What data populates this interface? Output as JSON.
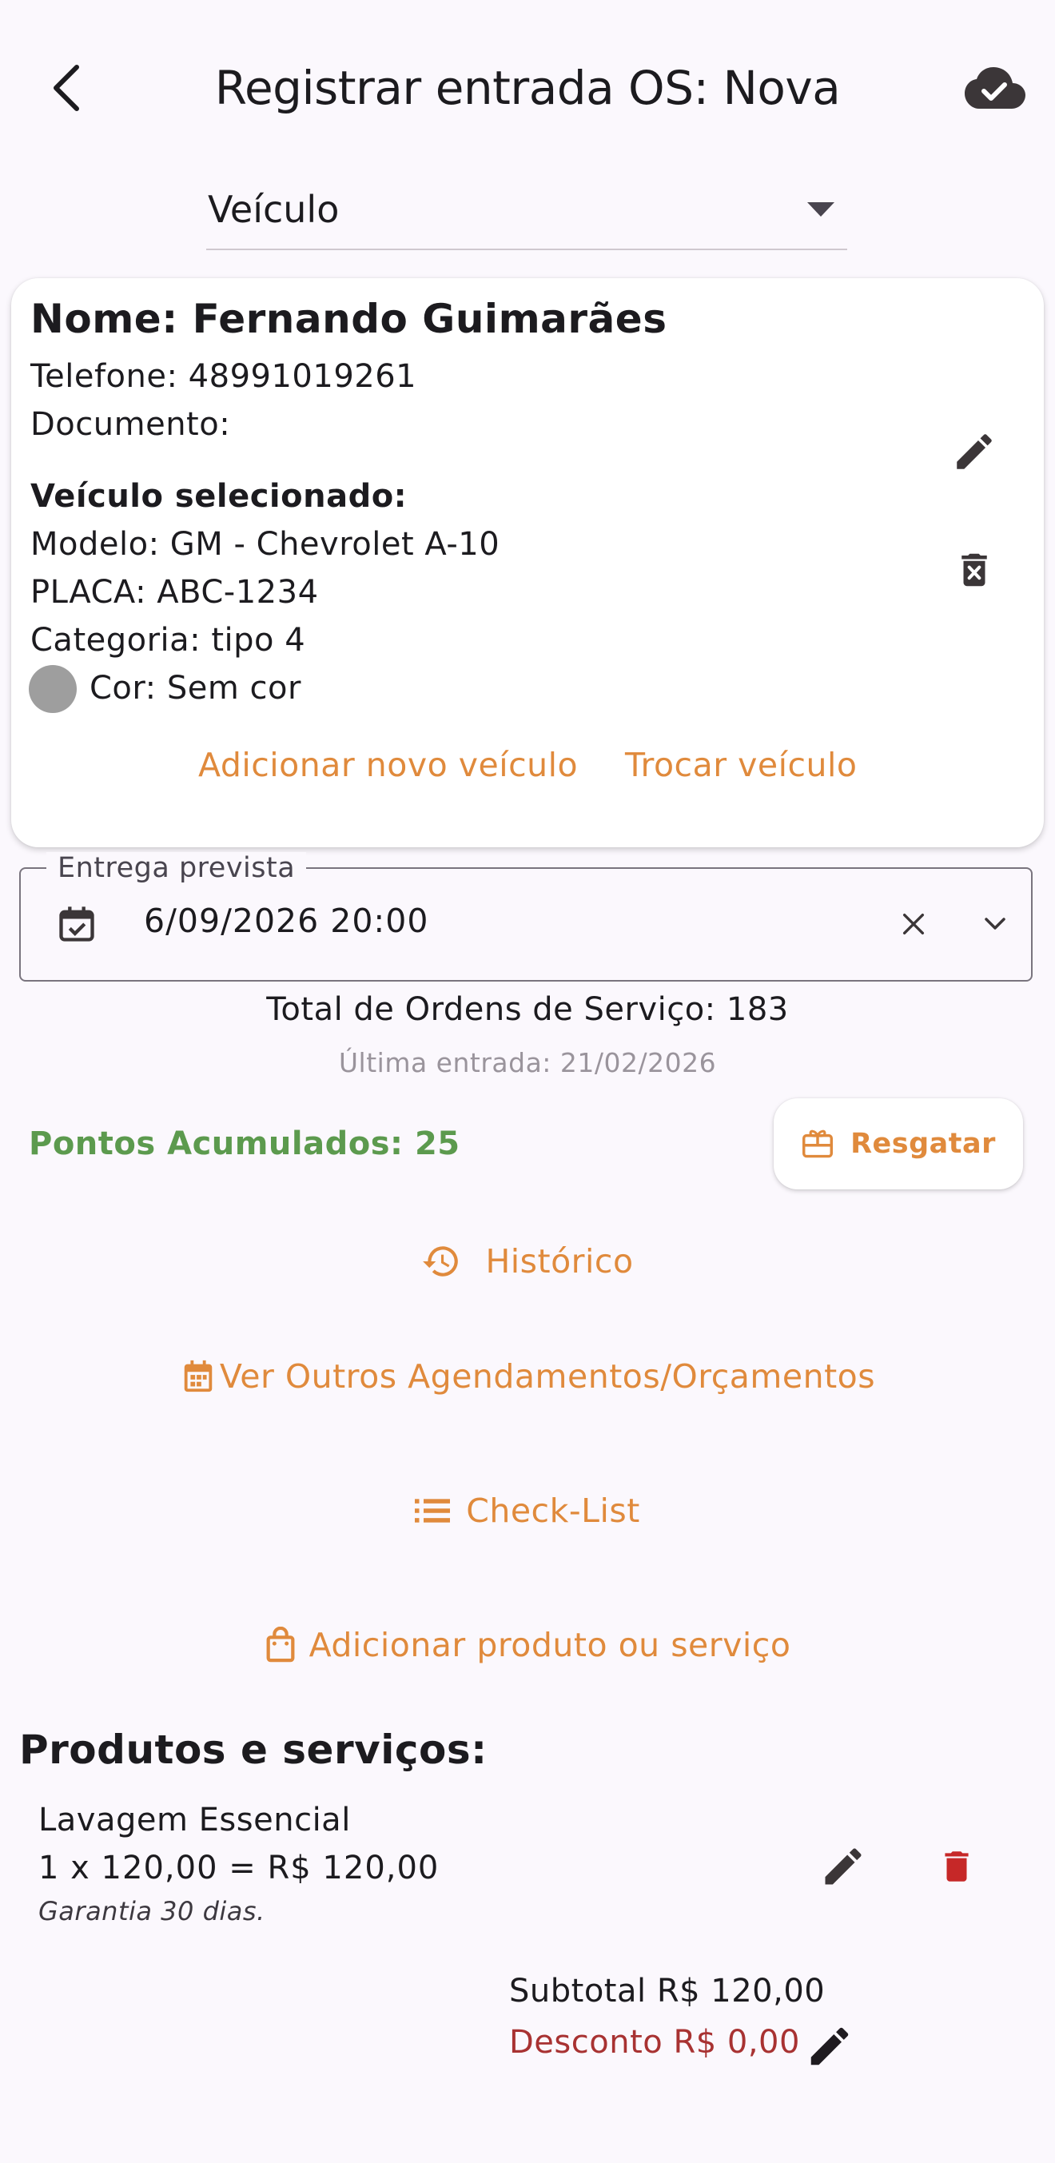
{
  "app_bar": {
    "title": "Registrar entrada OS: Nova",
    "back_icon": "chevron-left-icon",
    "sync_icon": "cloud-check-icon"
  },
  "vehicle_dropdown": {
    "selected": "Veículo"
  },
  "client": {
    "name": "Nome: Fernando Guimarães",
    "phone": "Telefone: 48991019261",
    "document": "Documento:",
    "selected_vehicle_title": "Veículo selecionado:",
    "model": "Modelo: GM - Chevrolet A-10",
    "plate": "PLACA: ABC-1234",
    "category": "Categoria: tipo 4",
    "color": "Cor: Sem cor",
    "color_swatch": "#9e9e9e",
    "add_vehicle": "Adicionar novo veículo",
    "swap_vehicle": "Trocar veículo"
  },
  "delivery": {
    "label": "Entrega prevista",
    "value": "6/09/2026 20:00"
  },
  "stats": {
    "total_os": "Total de Ordens de Serviço: 183",
    "last_entry": "Última entrada: 21/02/2026",
    "points": "Pontos Acumulados: 25",
    "redeem": "Resgatar"
  },
  "actions": {
    "history": "Histórico",
    "schedules": "Ver Outros Agendamentos/Orçamentos",
    "checklist": "Check-List",
    "add_product": "Adicionar produto ou serviço"
  },
  "products": {
    "title": "Produtos e serviços:",
    "items": [
      {
        "name": "Lavagem Essencial",
        "calc": "1 x 120,00 = R$ 120,00",
        "warranty": "Garantia 30 dias."
      }
    ]
  },
  "totals": {
    "subtotal": "Subtotal R$ 120,00",
    "discount": "Desconto R$ 0,00"
  },
  "colors": {
    "accent": "#e08a3c",
    "points_green": "#5c9a4e",
    "danger": "#a83232",
    "delete_red": "#c62828",
    "background": "#fbf8fd"
  }
}
